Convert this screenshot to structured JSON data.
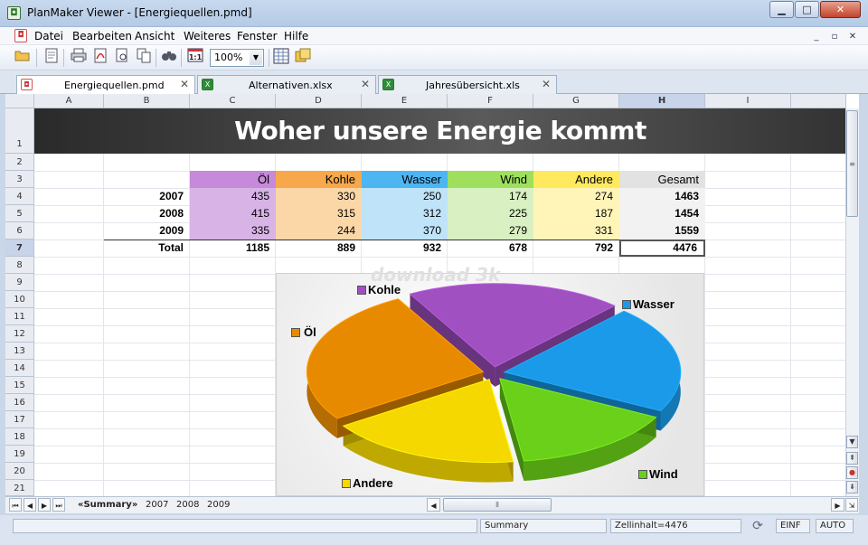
{
  "window": {
    "title": "PlanMaker Viewer - [Energiequellen.pmd]",
    "minimize": "▁",
    "maximize": "□",
    "close": "✕"
  },
  "menu": {
    "items": [
      "Datei",
      "Bearbeiten",
      "Ansicht",
      "Weiteres",
      "Fenster",
      "Hilfe"
    ],
    "mdi": [
      "_",
      "▫",
      "✕"
    ]
  },
  "toolbar": {
    "zoom": "100%"
  },
  "tabs": [
    {
      "label": "Energiequellen.pmd",
      "active": true
    },
    {
      "label": "Alternativen.xlsx",
      "active": false
    },
    {
      "label": "Jahresübersicht.xls",
      "active": false
    }
  ],
  "columns": [
    "A",
    "B",
    "C",
    "D",
    "E",
    "F",
    "G",
    "H",
    "I"
  ],
  "selected_column": "H",
  "rows": [
    "1",
    "2",
    "3",
    "4",
    "5",
    "6",
    "7",
    "8",
    "9",
    "10",
    "11",
    "12",
    "13",
    "14",
    "15",
    "16",
    "17",
    "18",
    "19",
    "20",
    "21"
  ],
  "selected_row": "7",
  "sheet_title": "Woher unsere Energie kommt",
  "table": {
    "headers": [
      "Öl",
      "Kohle",
      "Wasser",
      "Wind",
      "Andere",
      "Gesamt"
    ],
    "rows": [
      {
        "label": "2007",
        "values": [
          "435",
          "330",
          "250",
          "174",
          "274",
          "1463"
        ]
      },
      {
        "label": "2008",
        "values": [
          "415",
          "315",
          "312",
          "225",
          "187",
          "1454"
        ]
      },
      {
        "label": "2009",
        "values": [
          "335",
          "244",
          "370",
          "279",
          "331",
          "1559"
        ]
      }
    ],
    "total": {
      "label": "Total",
      "values": [
        "1185",
        "889",
        "932",
        "678",
        "792",
        "4476"
      ]
    }
  },
  "chart_data": {
    "type": "pie",
    "title": "",
    "categories": [
      "Öl",
      "Kohle",
      "Wasser",
      "Wind",
      "Andere"
    ],
    "values": [
      1185,
      889,
      932,
      678,
      792
    ],
    "colors": [
      "#e88a00",
      "#a050c0",
      "#1a9ae8",
      "#6ad01a",
      "#f5d800"
    ],
    "legend_placement": "labels beside slices"
  },
  "watermark": "download 3k",
  "sheet_tabs": [
    {
      "label": "«Summary»",
      "active": true
    },
    {
      "label": "2007",
      "active": false
    },
    {
      "label": "2008",
      "active": false
    },
    {
      "label": "2009",
      "active": false
    }
  ],
  "status": {
    "sheet": "Summary",
    "cell": "Zellinhalt=4476",
    "mode1": "EINF",
    "mode2": "AUTO"
  },
  "colors": {
    "oel": "#d7b3e6",
    "kohle": "#fbd7a8",
    "wasser": "#bfe3f8",
    "wind": "#d8f0c2",
    "andere": "#fff5b8",
    "gesamt": "#f2f2f2"
  }
}
